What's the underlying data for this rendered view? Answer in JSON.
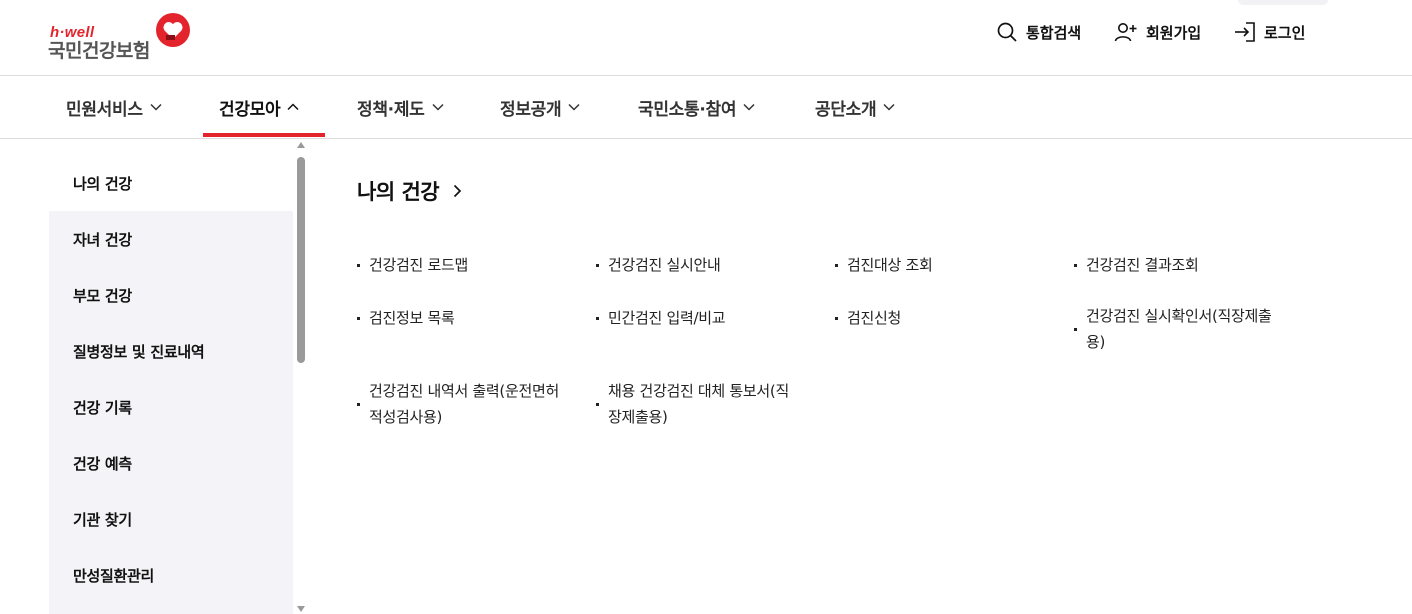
{
  "logo": {
    "top_text": "h·well",
    "name": "국민건강보험"
  },
  "header": {
    "search_label": "통합검색",
    "join_label": "회원가입",
    "login_label": "로그인"
  },
  "gnb": {
    "items": [
      {
        "label": "민원서비스",
        "active": false
      },
      {
        "label": "건강모아",
        "active": true
      },
      {
        "label": "정책·제도",
        "active": false
      },
      {
        "label": "정보공개",
        "active": false
      },
      {
        "label": "국민소통·참여",
        "active": false
      },
      {
        "label": "공단소개",
        "active": false
      }
    ]
  },
  "sidebar": {
    "items": [
      {
        "label": "나의 건강",
        "active": true
      },
      {
        "label": "자녀 건강"
      },
      {
        "label": "부모 건강"
      },
      {
        "label": "질병정보 및 진료내역"
      },
      {
        "label": "건강 기록"
      },
      {
        "label": "건강 예측"
      },
      {
        "label": "기관 찾기"
      },
      {
        "label": "만성질환관리"
      }
    ]
  },
  "content": {
    "title": "나의 건강",
    "links": [
      "건강검진 로드맵",
      "건강검진 실시안내",
      "검진대상 조회",
      "건강검진 결과조회",
      "검진정보 목록",
      "민간검진 입력/비교",
      "검진신청",
      "건강검진 실시확인서(직장제출용)",
      "건강검진 내역서 출력(운전면허적성검사용)",
      "채용 건강검진 대체 통보서(직장제출용)"
    ]
  },
  "colors": {
    "accent": "#e4242c",
    "sidebar_bg": "#f4f4f8",
    "text": "#111111"
  }
}
